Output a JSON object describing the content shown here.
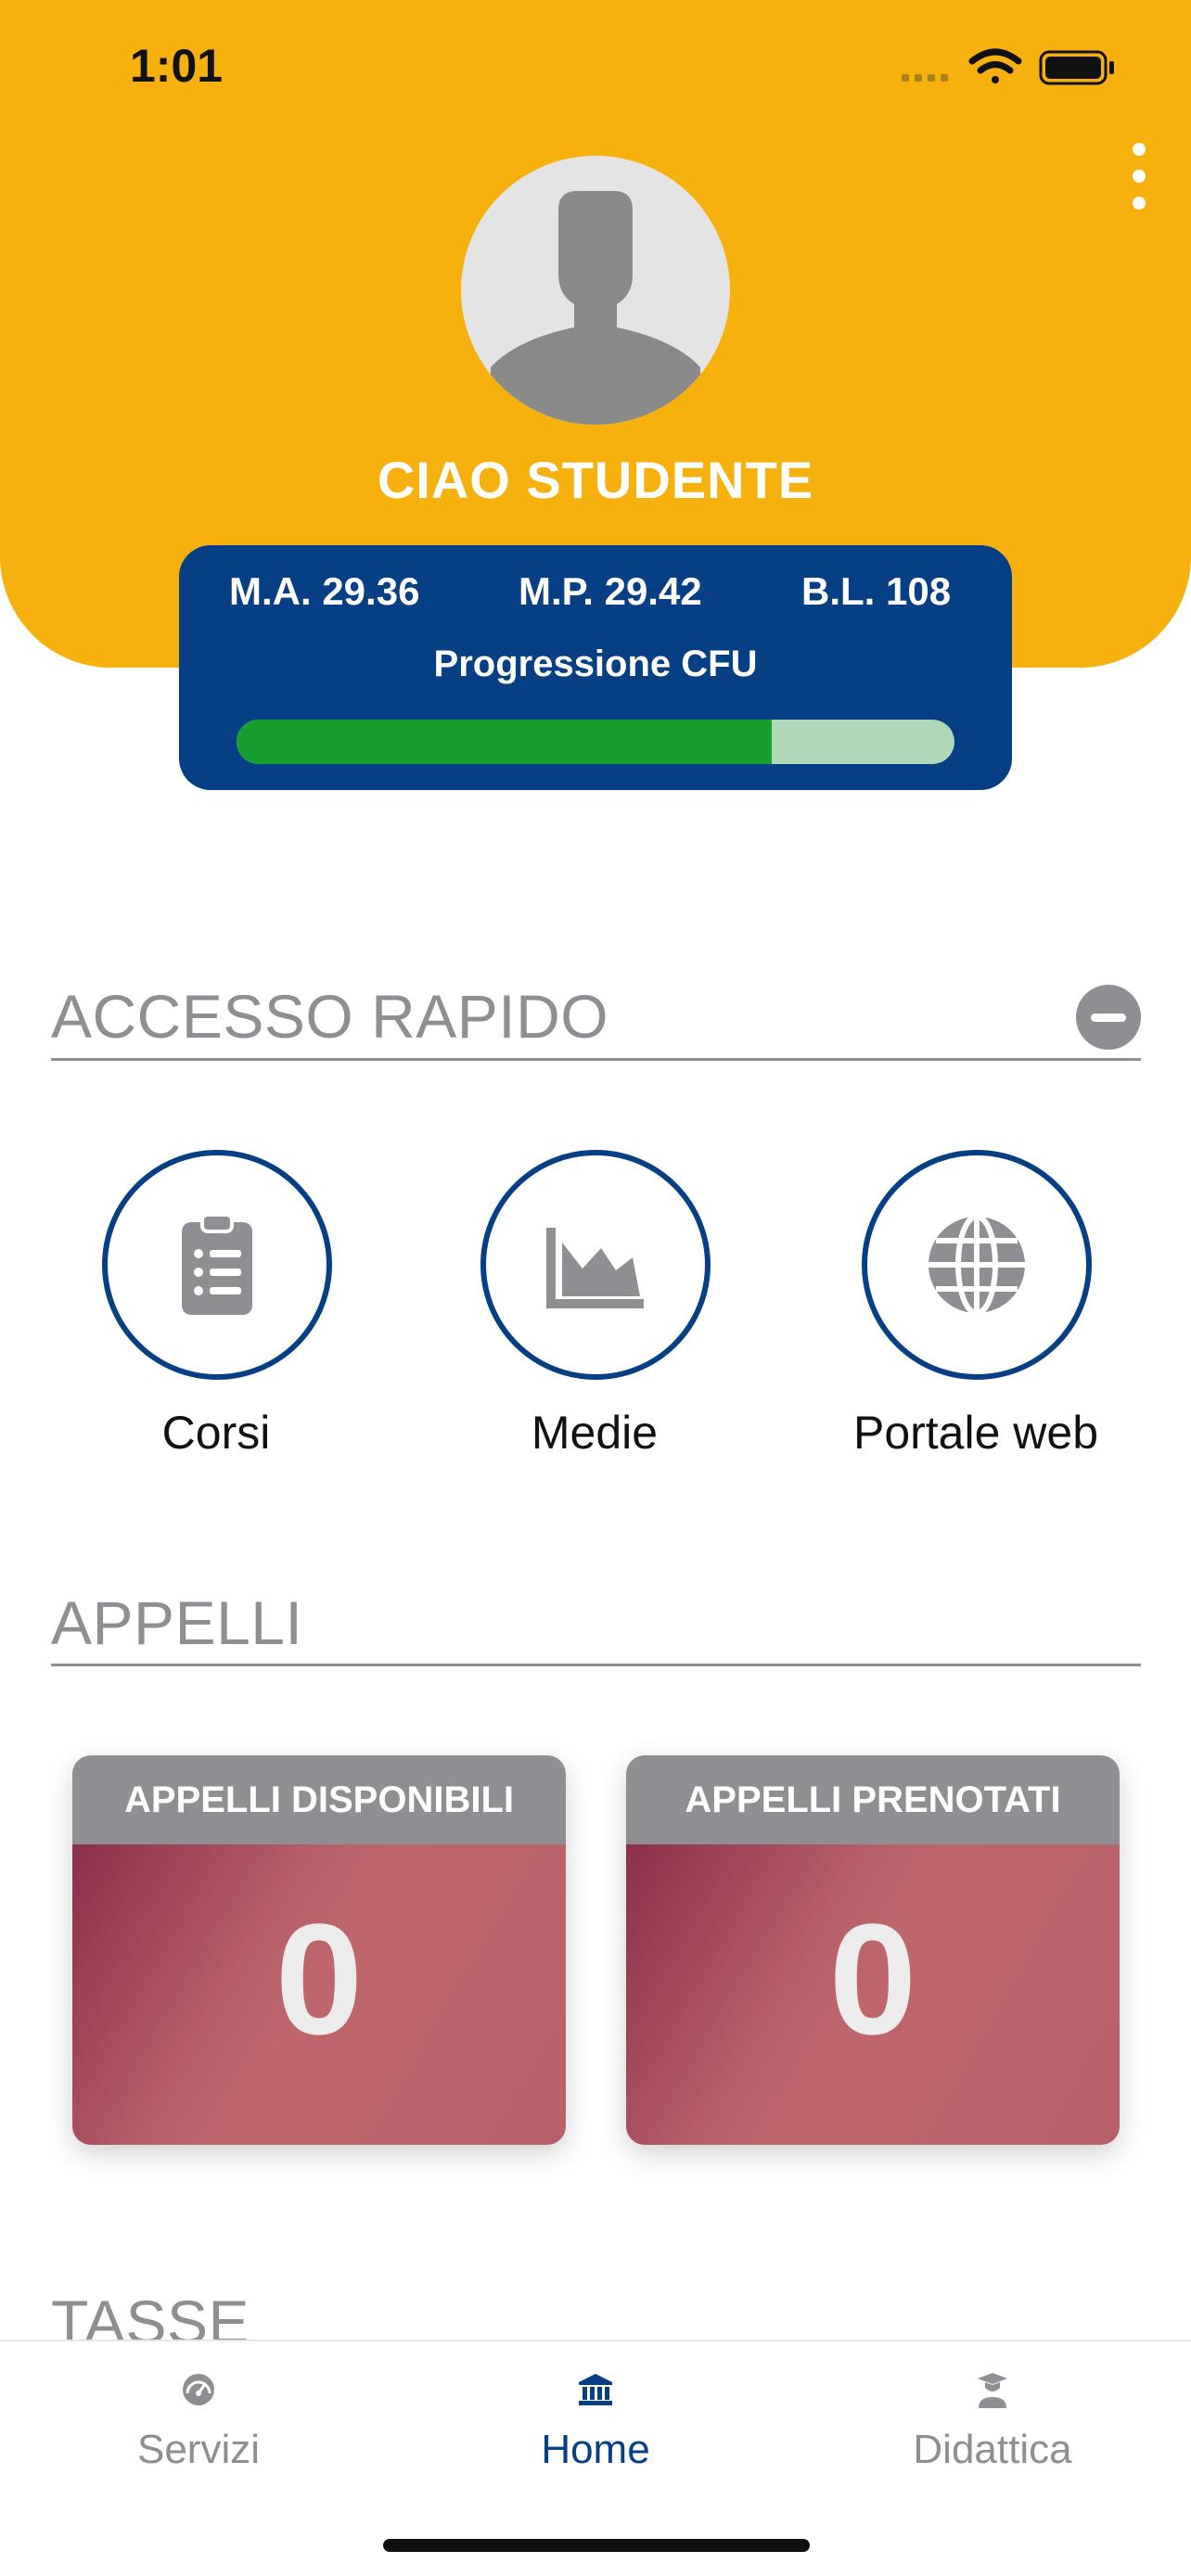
{
  "status_bar": {
    "time": "1:01",
    "icons": [
      "signal-icon",
      "wifi-icon",
      "battery-icon"
    ]
  },
  "header": {
    "menu_icon": "kebab-menu-icon",
    "avatar_icon": "person-silhouette-icon",
    "greeting": "CIAO STUDENTE"
  },
  "stats": {
    "ma": "M.A. 29.36",
    "mp": "M.P. 29.42",
    "bl": "B.L. 108",
    "progress_title": "Progressione CFU",
    "progress_fraction": 0.745
  },
  "quick_access": {
    "title": "ACCESSO RAPIDO",
    "collapse_icon": "minus-circle-icon",
    "items": [
      {
        "label": "Corsi",
        "icon": "clipboard-list-icon"
      },
      {
        "label": "Medie",
        "icon": "area-chart-icon"
      },
      {
        "label": "Portale web",
        "icon": "globe-icon"
      }
    ]
  },
  "appelli": {
    "title": "APPELLI",
    "cards": [
      {
        "title": "APPELLI DISPONIBILI",
        "count": "0"
      },
      {
        "title": "APPELLI PRENOTATI",
        "count": "0"
      }
    ]
  },
  "tasse": {
    "title": "TASSE"
  },
  "tabbar": {
    "tabs": [
      {
        "label": "Servizi",
        "icon": "dashboard-gauge-icon",
        "active": false
      },
      {
        "label": "Home",
        "icon": "university-building-icon",
        "active": true
      },
      {
        "label": "Didattica",
        "icon": "graduate-user-icon",
        "active": false
      }
    ]
  },
  "colors": {
    "header_yellow": "#F6B10F",
    "navy": "#073F84",
    "progress_green": "#179E2F",
    "progress_track": "#AED8B7",
    "gray": "#8E8E93",
    "card_red": "#B8606A"
  }
}
